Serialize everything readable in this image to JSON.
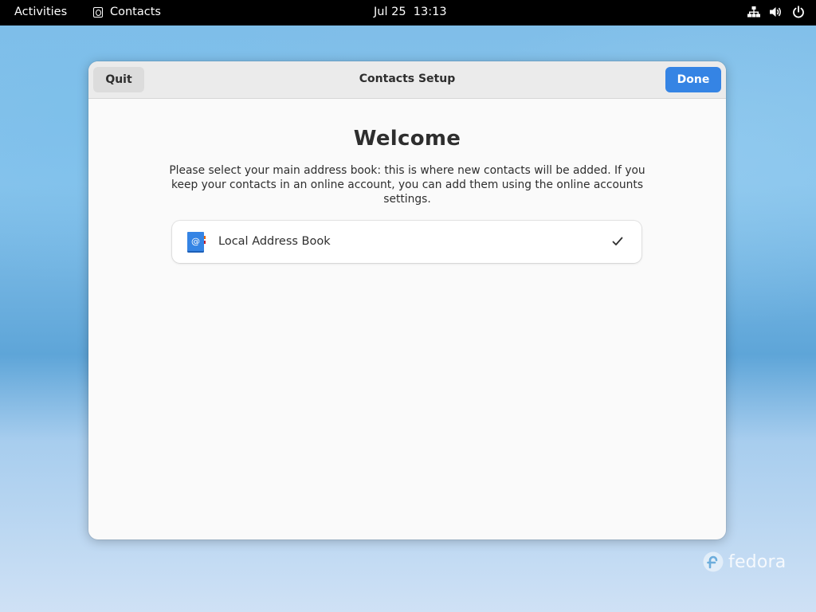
{
  "topbar": {
    "activities_label": "Activities",
    "app_name": "Contacts",
    "clock": "Jul 25  13:13",
    "status_icons": [
      "network-wired-icon",
      "volume-icon",
      "power-icon"
    ]
  },
  "window": {
    "title": "Contacts Setup",
    "quit_label": "Quit",
    "done_label": "Done",
    "heading": "Welcome",
    "description": "Please select your main address book: this is where new contacts will be added. If you keep your contacts in an online account, you can add them using the online accounts settings.",
    "address_books": [
      {
        "label": "Local Address Book",
        "icon": "address-book-icon",
        "selected": true
      }
    ]
  },
  "desktop": {
    "brand": "fedora"
  },
  "colors": {
    "accent": "#3584e4",
    "topbar": "#000000",
    "window_bg": "#fafafa",
    "headerbar_bg": "#ebebeb"
  }
}
